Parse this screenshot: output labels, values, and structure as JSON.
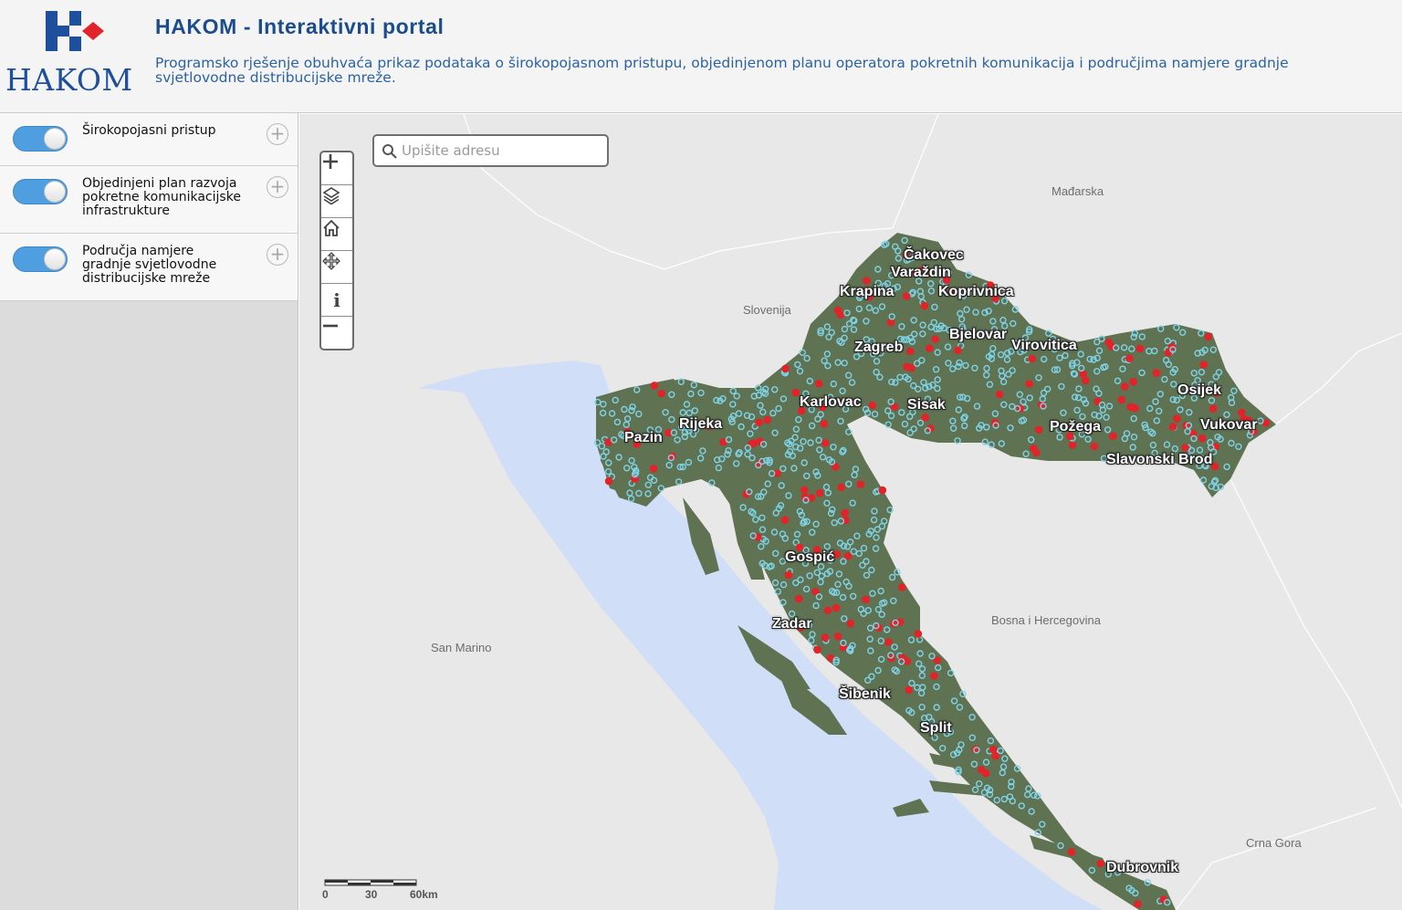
{
  "header": {
    "logo_text": "HAKOM",
    "title": "HAKOM - Interaktivni portal",
    "description_line1": "Programsko rješenje obuhvaća prikaz podataka o širokopojasnom pristupu, objedinjenom planu operatora pokretnih komunikacija i područjima namjere gradnje",
    "description_line2": "svjetlovodne distribucijske mreže."
  },
  "sidebar": {
    "layers": [
      {
        "line1": "Širokopojasni pristup",
        "line2": "",
        "line3": "",
        "enabled": true
      },
      {
        "line1": "Objedinjeni plan razvoja",
        "line2": "pokretne komunikacijske",
        "line3": "infrastrukture",
        "enabled": true
      },
      {
        "line1": "Područja namjere",
        "line2": "gradnje svjetlovodne",
        "line3": "distribucijske mreže",
        "enabled": true
      }
    ],
    "expand_symbol": "+"
  },
  "map": {
    "search": {
      "placeholder": "Upišite adresu",
      "value": ""
    },
    "controls": [
      "zoom-in",
      "layers",
      "home",
      "pan",
      "info",
      "zoom-out"
    ],
    "info_symbol": "i",
    "countries": {
      "hungary": "Mađarska",
      "slovenia": "Slovenija",
      "bosnia": "Bosna i Hercegovina",
      "san_marino": "San Marino",
      "montenegro": "Crna Gora"
    },
    "cities": {
      "cakovec": "Čakovec",
      "varazdin": "Varaždin",
      "krapina": "Krapina",
      "koprivnica": "Koprivnica",
      "zagreb": "Zagreb",
      "bjelovar": "Bjelovar",
      "virovitica": "Virovitica",
      "osijek": "Osijek",
      "karlovac": "Karlovac",
      "sisak": "Sisak",
      "rijeka": "Rijeka",
      "pazin": "Pazin",
      "pozega": "Požega",
      "vukovar": "Vukovar",
      "slavonski_brod": "Slavonski Brod",
      "gospic": "Gospić",
      "zadar": "Zadar",
      "sibenik": "Šibenik",
      "split": "Split",
      "dubrovnik": "Dubrovnik"
    },
    "scale": {
      "labels": [
        "0",
        "30",
        "60km"
      ]
    },
    "colors": {
      "sea": "#d0def7",
      "land": "#e8e8e8",
      "territory": "#5f7352",
      "marker_cyan": "#7fd3e8",
      "marker_red": "#e0242a",
      "brand_blue": "#1b4d8c",
      "toggle_blue": "#4f9fe0"
    }
  }
}
